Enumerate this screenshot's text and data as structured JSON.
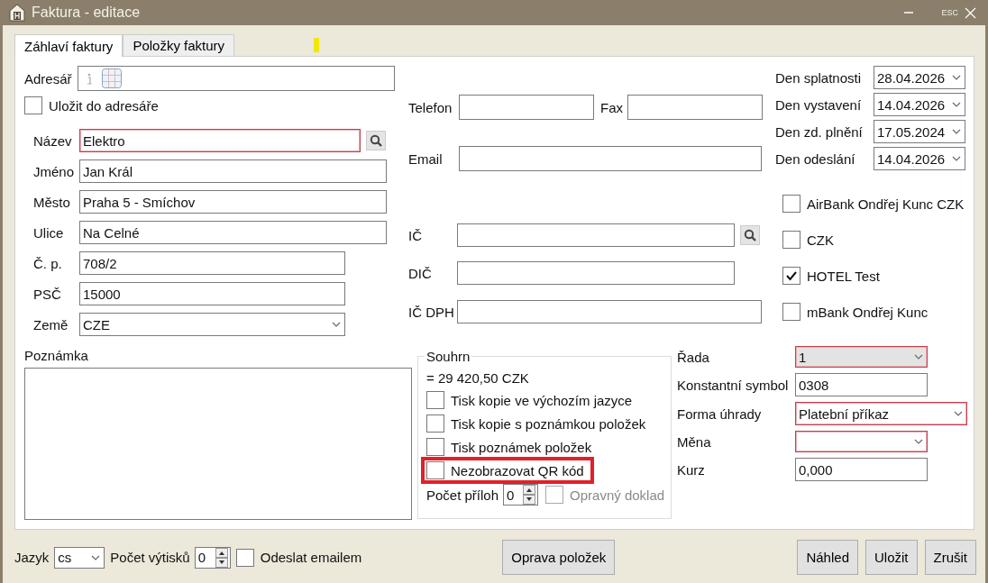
{
  "window": {
    "title": "Faktura - editace",
    "close_hint": "ESC"
  },
  "tabs": [
    {
      "label": "Záhlaví faktury",
      "selected": true
    },
    {
      "label": "Položky faktury",
      "selected": false
    }
  ],
  "address_book": {
    "label": "Adresář"
  },
  "save_to_address_book": {
    "label": "Uložit do adresáře",
    "checked": false
  },
  "customer_fields": [
    {
      "label": "Název",
      "value": "Elektro",
      "kind": "text",
      "invalid": true,
      "search": true
    },
    {
      "label": "Jméno",
      "value": "Jan Král",
      "kind": "text",
      "invalid": false,
      "search": false
    },
    {
      "label": "Město",
      "value": "Praha 5 - Smíchov",
      "kind": "text",
      "invalid": false,
      "search": false
    },
    {
      "label": "Ulice",
      "value": "Na Celné",
      "kind": "text",
      "invalid": false,
      "search": false
    },
    {
      "label": "Č. p.",
      "value": "708/2",
      "kind": "text",
      "invalid": false,
      "search": false
    },
    {
      "label": "PSČ",
      "value": "15000",
      "kind": "text",
      "invalid": false,
      "search": false
    },
    {
      "label": "Země",
      "value": "CZE",
      "kind": "select",
      "invalid": false,
      "search": false
    }
  ],
  "contact": {
    "phone_label": "Telefon",
    "fax_label": "Fax",
    "email_label": "Email"
  },
  "company_ids": [
    {
      "label": "IČ",
      "search": true
    },
    {
      "label": "DIČ",
      "search": false
    },
    {
      "label": "IČ DPH",
      "search": false
    }
  ],
  "dates": [
    {
      "label": "Den splatnosti",
      "value": "28.04.2026"
    },
    {
      "label": "Den vystavení",
      "value": "14.04.2026"
    },
    {
      "label": "Den zd. plnění",
      "value": "17.05.2024"
    },
    {
      "label": "Den odeslání",
      "value": "14.04.2026"
    }
  ],
  "bank_accounts": [
    {
      "label": "AirBank Ondřej Kunc CZK",
      "checked": false
    },
    {
      "label": "CZK",
      "checked": false
    },
    {
      "label": "HOTEL Test",
      "checked": true
    },
    {
      "label": "mBank Ondřej Kunc",
      "checked": false
    }
  ],
  "note": {
    "label": "Poznámka"
  },
  "summary": {
    "title": "Souhrn",
    "total": "= 29 420,50 CZK",
    "options": [
      {
        "label": "Tisk kopie ve výchozím jazyce",
        "checked": false,
        "highlighted": false
      },
      {
        "label": "Tisk kopie s poznámkou položek",
        "checked": false,
        "highlighted": false
      },
      {
        "label": "Tisk poznámek položek",
        "checked": false,
        "highlighted": false
      },
      {
        "label": "Nezobrazovat QR kód",
        "checked": false,
        "highlighted": true
      }
    ],
    "attachments": {
      "label": "Počet příloh",
      "value": "0"
    },
    "correction": {
      "label": "Opravný doklad",
      "checked": false,
      "disabled": true
    }
  },
  "document_fields": [
    {
      "label": "Řada",
      "value": "1",
      "kind": "select",
      "invalid": true,
      "disabled": true
    },
    {
      "label": "Konstantní symbol",
      "value": "0308",
      "kind": "text",
      "invalid": false,
      "disabled": false
    },
    {
      "label": "Forma úhrady",
      "value": "Platební příkaz",
      "kind": "select",
      "invalid": true,
      "disabled": false
    },
    {
      "label": "Měna",
      "kind": "select",
      "invalid": true,
      "disabled": false
    },
    {
      "label": "Kurz",
      "value": "0,000",
      "kind": "text",
      "invalid": false,
      "disabled": false
    }
  ],
  "footer": {
    "language": {
      "label": "Jazyk",
      "value": "cs"
    },
    "copies": {
      "label": "Počet výtisků",
      "value": "0"
    },
    "send_email": {
      "label": "Odeslat emailem",
      "checked": false
    },
    "fix_button": "Oprava položek",
    "buttons": [
      "Náhled",
      "Uložit",
      "Zrušit"
    ]
  }
}
